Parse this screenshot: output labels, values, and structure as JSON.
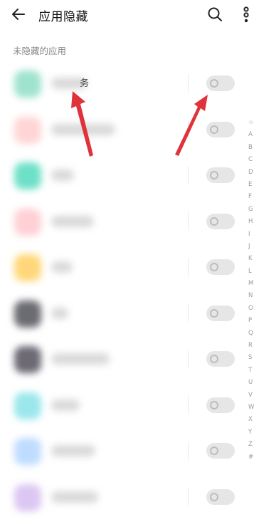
{
  "header": {
    "title": "应用隐藏",
    "back_icon": "arrow-left-icon",
    "search_icon": "search-icon",
    "more_icon": "more-vertical-icon"
  },
  "section": {
    "label": "未隐藏的应用"
  },
  "apps": [
    {
      "name_suffix": "务",
      "icon_color": "#9fe3cf",
      "toggle_on": false
    },
    {
      "name_suffix": "",
      "icon_color": "#ffd5d5",
      "toggle_on": false
    },
    {
      "name_suffix": "",
      "icon_color": "#6ee0c8",
      "toggle_on": false
    },
    {
      "name_suffix": "",
      "icon_color": "#ffd0d6",
      "toggle_on": false
    },
    {
      "name_suffix": "",
      "icon_color": "#ffd77a",
      "toggle_on": false
    },
    {
      "name_suffix": "",
      "icon_color": "#6b6b72",
      "toggle_on": false
    },
    {
      "name_suffix": "",
      "icon_color": "#6d6a75",
      "toggle_on": false
    },
    {
      "name_suffix": "",
      "icon_color": "#9be7ec",
      "toggle_on": false
    },
    {
      "name_suffix": "",
      "icon_color": "#bfdcff",
      "toggle_on": false
    },
    {
      "name_suffix": "",
      "icon_color": "#dcc7f2",
      "toggle_on": false
    }
  ],
  "index_letters": [
    "☆",
    "A",
    "B",
    "C",
    "D",
    "E",
    "F",
    "G",
    "H",
    "I",
    "J",
    "K",
    "L",
    "M",
    "N",
    "O",
    "P",
    "Q",
    "R",
    "S",
    "T",
    "U",
    "V",
    "W",
    "X",
    "Y",
    "Z",
    "#"
  ],
  "annotation_color": "#e0323a"
}
